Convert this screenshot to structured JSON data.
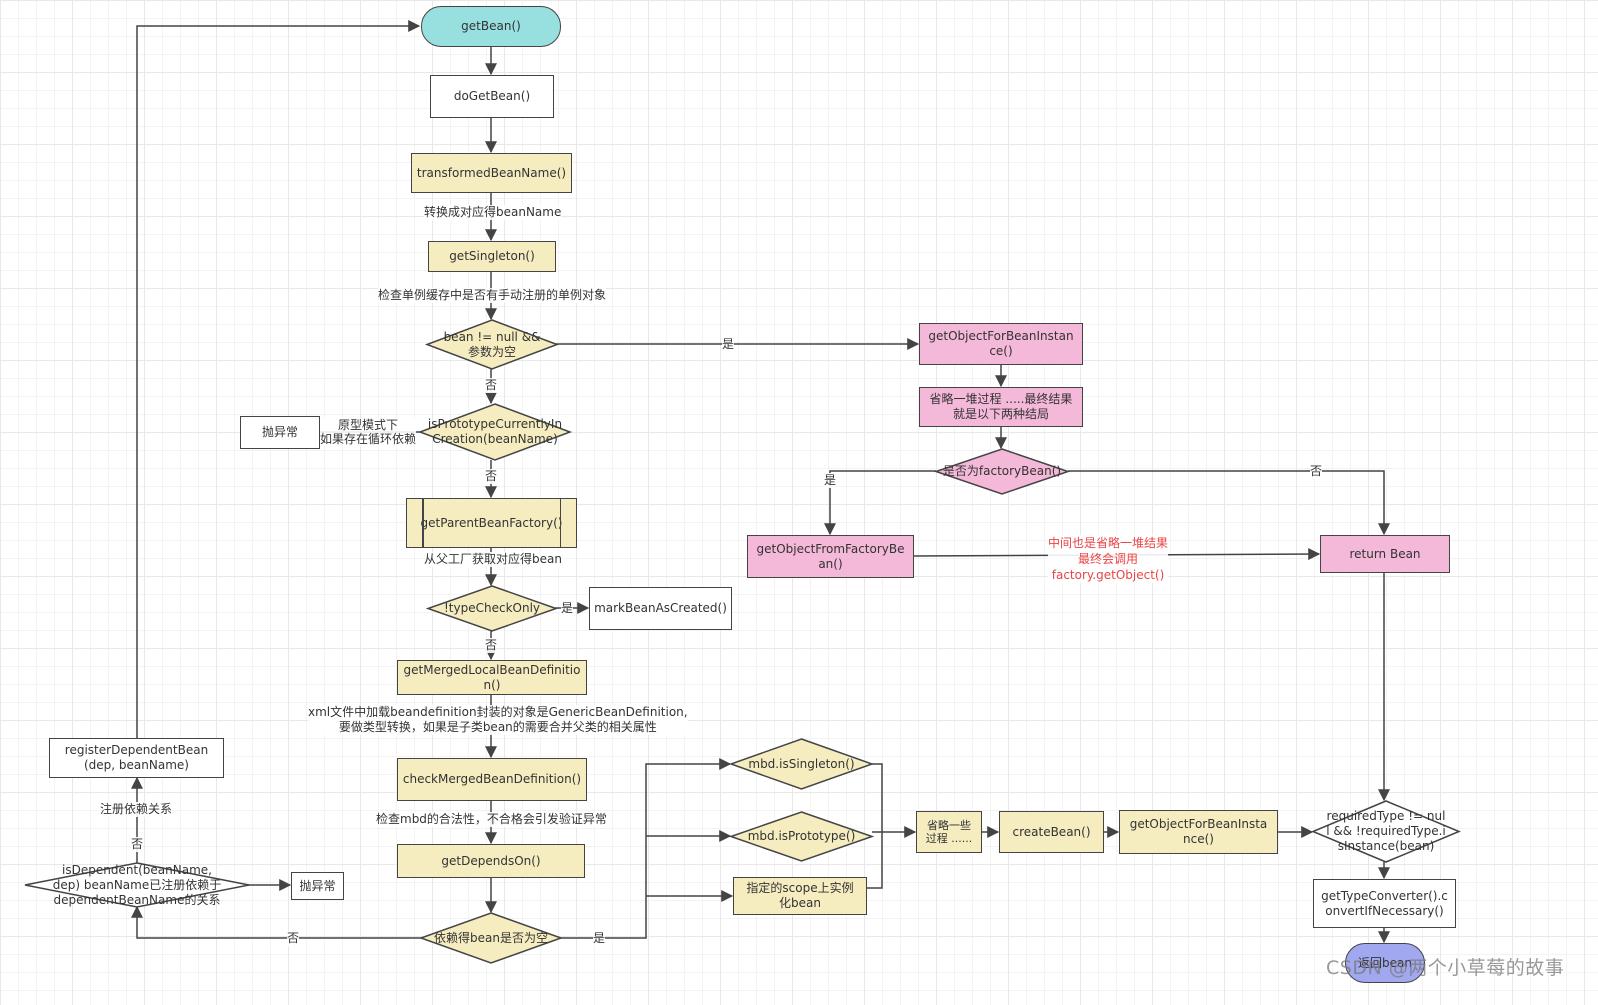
{
  "colors": {
    "start_node": "#98e0e0",
    "end_node": "#a1a8ef",
    "process_yellow": "#f5ecc0",
    "process_pink": "#f4b8d8",
    "annotation_red": "#e84545",
    "edge": "#444444"
  },
  "nodes": {
    "get_bean": "getBean()",
    "do_get_bean": "doGetBean()",
    "transformed_bean_name": "transformedBeanName()",
    "get_singleton": "getSingleton()",
    "bean_not_null": "bean != null && 参数为空",
    "is_prototype_in_creation": "isPrototypeCurrentlyInCreation(beanName)",
    "throw_exception_1": "抛异常",
    "get_parent_bean_factory": "getParentBeanFactory()",
    "type_check_only": "!typeCheckOnly",
    "mark_bean_as_created": "markBeanAsCreated()",
    "get_merged_local_bean_definition": "getMergedLocalBeanDefinition()",
    "check_merged_bean_definition": "checkMergedBeanDefinition()",
    "get_depends_on": "getDependsOn()",
    "depends_empty": "依赖得bean是否为空",
    "is_dependent": "isDependent(beanName, dep) beanName已注册依赖于dependentBeanName的关系",
    "throw_exception_2": "抛异常",
    "register_dependent_bean": "registerDependentBean(dep, beanName)",
    "mbd_is_singleton": "mbd.isSingleton()",
    "mbd_is_prototype": "mbd.isPrototype()",
    "scope_instantiate": "指定的scope上实例化bean",
    "omit_some_process": "省略一些过程 ......",
    "create_bean": "createBean()",
    "get_object_for_bean_instance_bottom": "getObjectForBeanInstance()",
    "required_type_check": "requiredType != null && !requiredType.isInstance(bean)",
    "get_type_converter": "getTypeConverter().convertIfNecessary()",
    "return_end": "返回bean",
    "get_object_for_bean_instance_top": "getObjectForBeanInstance()",
    "omit_pile_process": "省略一堆过程 .....最终结果就是以下两种结局",
    "is_factory_bean": "是否为factoryBean()",
    "get_object_from_factory_bean": "getObjectFromFactoryBean()",
    "return_bean": "return Bean"
  },
  "edge_labels": {
    "to_bean_name": "转换成对应得beanName",
    "check_singleton_cache": "检查单例缓存中是否有手动注册的单例对象",
    "yes_1": "是",
    "no_1": "否",
    "prototype_cycle_line1": "原型模式下",
    "prototype_cycle_line2": "如果存在循环依赖",
    "no_2": "否",
    "get_from_parent": "从父工厂获取对应得bean",
    "yes_2": "是",
    "no_3": "否",
    "merged_note_line1": "xml文件中加载beandefinition封装的对象是GenericBeanDefinition,",
    "merged_note_line2": "要做类型转换，如果是子类bean的需要合并父类的相关属性",
    "check_mbd_note": "检查mbd的合法性，不合格会引发验证异常",
    "depends_yes": "是",
    "depends_no": "否",
    "is_dependent_no": "否",
    "register_relation": "注册依赖关系",
    "factory_yes": "是",
    "factory_no": "否",
    "factory_note_line1": "中间也是省略一堆结果",
    "factory_note_line2": "最终会调用",
    "factory_note_line3": "factory.getObject()"
  },
  "watermark": "CSDN @两个小草莓的故事"
}
